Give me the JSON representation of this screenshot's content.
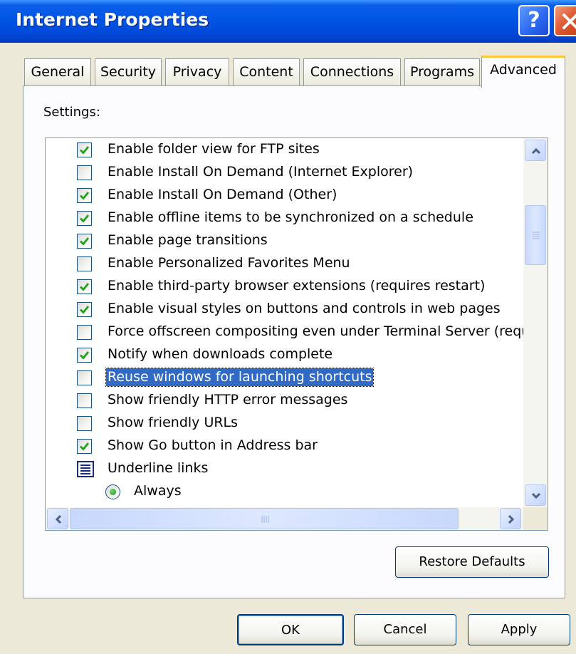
{
  "window": {
    "title": "Internet Properties",
    "help_label": "?",
    "accent": "#0055e5"
  },
  "tabs": [
    {
      "label": "General",
      "active": false
    },
    {
      "label": "Security",
      "active": false
    },
    {
      "label": "Privacy",
      "active": false
    },
    {
      "label": "Content",
      "active": false
    },
    {
      "label": "Connections",
      "active": false
    },
    {
      "label": "Programs",
      "active": false
    },
    {
      "label": "Advanced",
      "active": true
    }
  ],
  "settings": {
    "label": "Settings:",
    "items": [
      {
        "type": "checkbox",
        "checked": true,
        "label": "Enable folder view for FTP sites"
      },
      {
        "type": "checkbox",
        "checked": false,
        "label": "Enable Install On Demand (Internet Explorer)"
      },
      {
        "type": "checkbox",
        "checked": true,
        "label": "Enable Install On Demand (Other)"
      },
      {
        "type": "checkbox",
        "checked": true,
        "label": "Enable offline items to be synchronized on a schedule"
      },
      {
        "type": "checkbox",
        "checked": true,
        "label": "Enable page transitions"
      },
      {
        "type": "checkbox",
        "checked": false,
        "label": "Enable Personalized Favorites Menu"
      },
      {
        "type": "checkbox",
        "checked": true,
        "label": "Enable third-party browser extensions (requires restart)"
      },
      {
        "type": "checkbox",
        "checked": true,
        "label": "Enable visual styles on buttons and controls in web pages"
      },
      {
        "type": "checkbox",
        "checked": false,
        "label": "Force offscreen compositing even under Terminal Server (requ"
      },
      {
        "type": "checkbox",
        "checked": true,
        "label": "Notify when downloads complete"
      },
      {
        "type": "checkbox",
        "checked": false,
        "label": "Reuse windows for launching shortcuts",
        "selected": true
      },
      {
        "type": "checkbox",
        "checked": false,
        "label": "Show friendly HTTP error messages"
      },
      {
        "type": "checkbox",
        "checked": false,
        "label": "Show friendly URLs"
      },
      {
        "type": "checkbox",
        "checked": true,
        "label": "Show Go button in Address bar"
      },
      {
        "type": "group",
        "label": "Underline links"
      },
      {
        "type": "radio",
        "checked": true,
        "label": "Always"
      }
    ]
  },
  "buttons": {
    "restore_defaults": "Restore Defaults",
    "ok": "OK",
    "cancel": "Cancel",
    "apply": "Apply"
  },
  "colors": {
    "checkmark": "#21a121",
    "selection": "#316ac5",
    "active_tab_highlight": "#ffc83c",
    "dialog_bg": "#ece9d8"
  }
}
